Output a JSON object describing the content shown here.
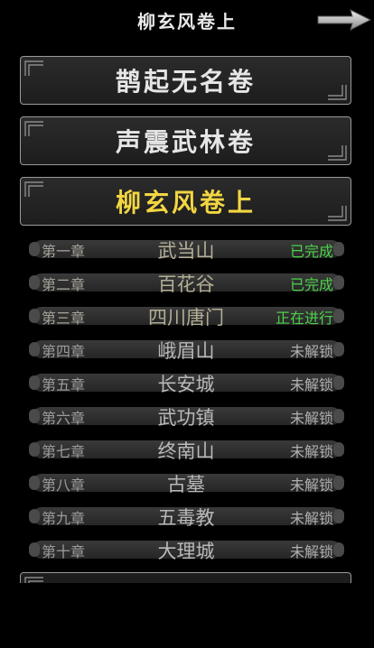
{
  "header": {
    "title": "柳玄风卷上",
    "next_icon": "arrow-right-icon"
  },
  "volumes": [
    {
      "label": "鹊起无名卷",
      "active": false
    },
    {
      "label": "声震武林卷",
      "active": false
    },
    {
      "label": "柳玄风卷上",
      "active": true
    }
  ],
  "chapters": [
    {
      "num": "第一章",
      "name": "武当山",
      "status": "已完成",
      "state": "done"
    },
    {
      "num": "第二章",
      "name": "百花谷",
      "status": "已完成",
      "state": "done"
    },
    {
      "num": "第三章",
      "name": "四川唐门",
      "status": "正在进行",
      "state": "progress"
    },
    {
      "num": "第四章",
      "name": "峨眉山",
      "status": "未解锁",
      "state": "locked"
    },
    {
      "num": "第五章",
      "name": "长安城",
      "status": "未解锁",
      "state": "locked"
    },
    {
      "num": "第六章",
      "name": "武功镇",
      "status": "未解锁",
      "state": "locked"
    },
    {
      "num": "第七章",
      "name": "终南山",
      "status": "未解锁",
      "state": "locked"
    },
    {
      "num": "第八章",
      "name": "古墓",
      "status": "未解锁",
      "state": "locked"
    },
    {
      "num": "第九章",
      "name": "五毒教",
      "status": "未解锁",
      "state": "locked"
    },
    {
      "num": "第十章",
      "name": "大理城",
      "status": "未解锁",
      "state": "locked"
    }
  ],
  "colors": {
    "active_volume": "#f2d642",
    "status_done": "#4cd24a",
    "status_locked": "#b0b0b0"
  }
}
